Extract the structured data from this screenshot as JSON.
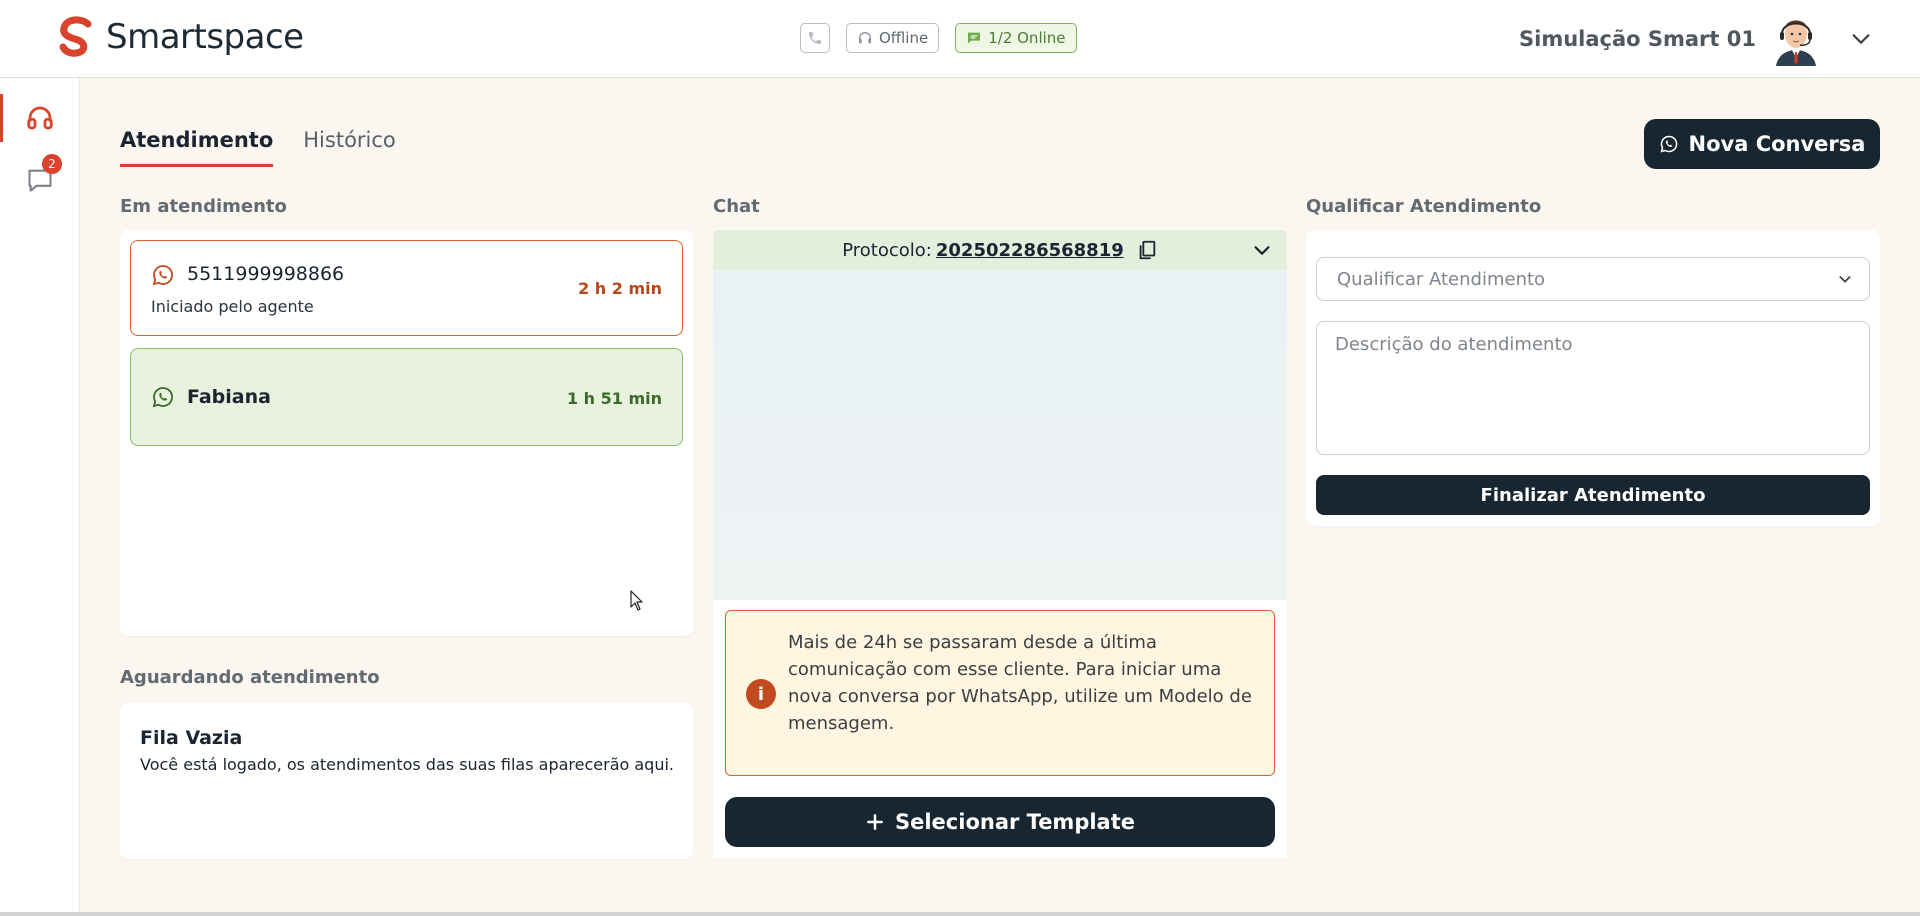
{
  "brand": {
    "name": "Smartspace",
    "color": "#d8432c"
  },
  "status": {
    "offline_label": "Offline",
    "online_label": "1/2 Online"
  },
  "user": {
    "name": "Simulação Smart 01"
  },
  "sidebar": {
    "chat_badge": "2"
  },
  "tabs": [
    {
      "label": "Atendimento"
    },
    {
      "label": "Histórico"
    }
  ],
  "actions": {
    "new_conversation": "Nova Conversa"
  },
  "sections": {
    "in_service": "Em atendimento",
    "waiting": "Aguardando atendimento",
    "chat": "Chat",
    "qualify": "Qualificar Atendimento"
  },
  "conversations": [
    {
      "name": "5511999998866",
      "subtitle": "Iniciado pelo agente",
      "time": "2 h 2 min"
    },
    {
      "name": "Fabiana",
      "time": "1 h 51 min"
    }
  ],
  "queue": {
    "title": "Fila Vazia",
    "text": "Você está logado, os atendimentos das suas filas aparecerão aqui."
  },
  "chat": {
    "protocol_label": "Protocolo:",
    "protocol_number": "202502286568819",
    "alert": "Mais de 24h se passaram desde a última comunicação com esse cliente. Para iniciar uma nova conversa por WhatsApp, utilize um Modelo de mensagem.",
    "template_button": "Selecionar Template"
  },
  "qualify": {
    "select_placeholder": "Qualificar Atendimento",
    "description_placeholder": "Descrição do atendimento",
    "finish_button": "Finalizar Atendimento"
  }
}
